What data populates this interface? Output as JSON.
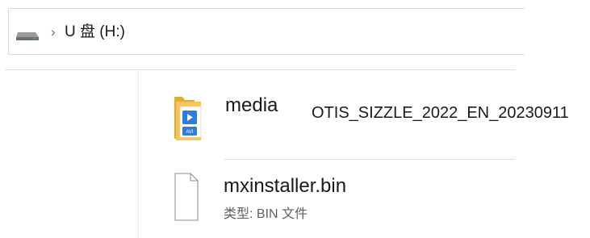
{
  "address_bar": {
    "drive_icon": "usb-drive-icon",
    "chevron": "›",
    "path_label": "U 盘 (H:)"
  },
  "files": [
    {
      "icon": "video-folder-icon",
      "icon_badge": "AVI",
      "name": "media",
      "title": "OTIS_SIZZLE_2022_EN_20230911"
    },
    {
      "icon": "blank-file-icon",
      "name": "mxinstaller.bin",
      "type_line": "类型: BIN 文件"
    }
  ],
  "colors": {
    "folder_yellow": "#f4c65a",
    "badge_blue": "#2a7de1",
    "separator": "#dedede"
  }
}
